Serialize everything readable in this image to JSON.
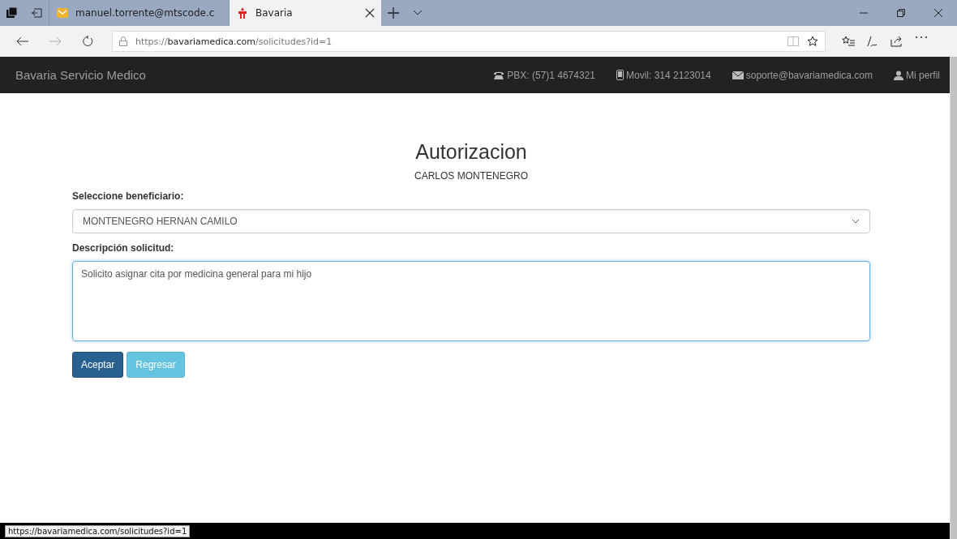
{
  "browser": {
    "tabs": [
      {
        "title": "manuel.torrente@mtscode.c",
        "kind": "mail",
        "selected": false
      },
      {
        "title": "Bavaria",
        "kind": "site",
        "selected": true
      }
    ],
    "address": {
      "scheme": "https://",
      "domain": "bavariamedica.com",
      "path": "/solicitudes?id=1"
    }
  },
  "navbar": {
    "brand": "Bavaria Servicio Medico",
    "items": [
      {
        "kind": "phone",
        "label": "PBX: (57)1 4674321"
      },
      {
        "kind": "mobile",
        "label": "Movil: 314 2123014"
      },
      {
        "kind": "mail",
        "label": "soporte@bavariamedica.com"
      },
      {
        "kind": "user",
        "label": "Mi perfil"
      }
    ]
  },
  "form": {
    "title": "Autorizacion",
    "subtitle": "CARLOS MONTENEGRO",
    "beneficiary": {
      "label": "Seleccione beneficiario:",
      "value": "MONTENEGRO HERNAN CAMILO"
    },
    "description": {
      "label": "Descripción solicitud:",
      "value": "Solicito asignar cita por medicina general para mi hijo",
      "focused": true
    },
    "buttons": [
      {
        "label": "Aceptar",
        "kind": "primary",
        "disabled": false
      },
      {
        "label": "Regresar",
        "kind": "info",
        "disabled": true
      }
    ]
  },
  "status_link": "https://bavariamedica.com/solicitudes?id=1"
}
